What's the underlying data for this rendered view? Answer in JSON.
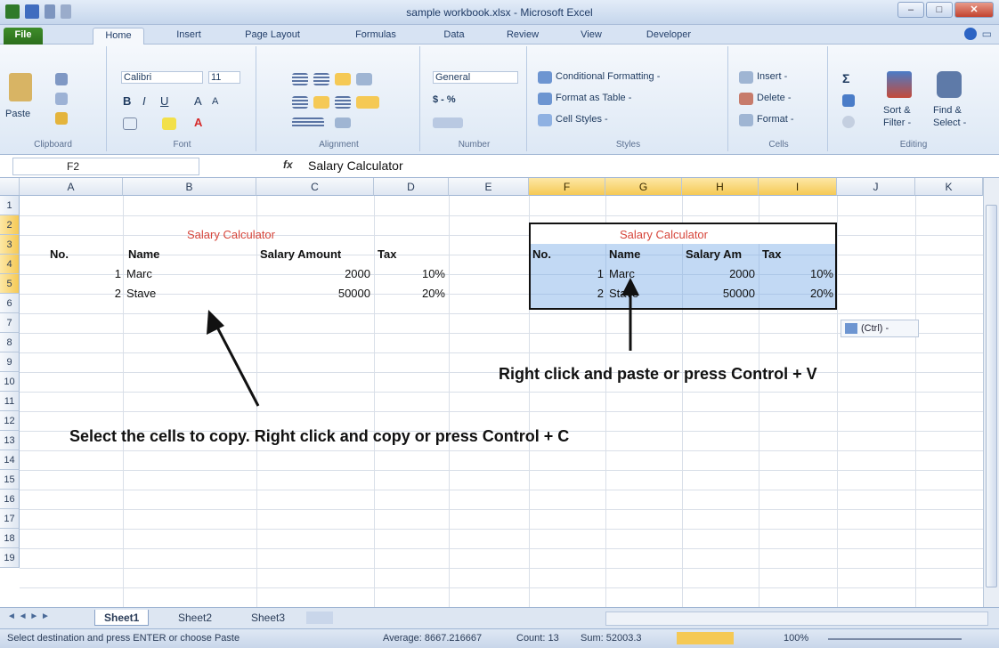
{
  "window": {
    "title": "sample workbook.xlsx - Microsoft Excel"
  },
  "tabs": [
    "File",
    "Home",
    "Insert",
    "Page Layout",
    "Formulas",
    "Data",
    "Review",
    "View",
    "Developer"
  ],
  "ribbon": {
    "clipboard": {
      "paste": "Paste",
      "label": "Clipboard"
    },
    "font": {
      "name": "Calibri",
      "size": "11",
      "label": "Font"
    },
    "alignment": {
      "label": "Alignment"
    },
    "number": {
      "format": "General",
      "currency": "$ - %",
      "label": "Number"
    },
    "styles": {
      "cond": "Conditional Formatting -",
      "table": "Format as Table -",
      "cell": "Cell Styles -",
      "label": "Styles"
    },
    "cells": {
      "insert": "Insert -",
      "delete": "Delete -",
      "format": "Format -",
      "label": "Cells"
    },
    "editing": {
      "sort": "Sort &",
      "filter": "Filter -",
      "find": "Find &",
      "select": "Select -",
      "label": "Editing"
    }
  },
  "formula_bar": {
    "name_box": "F2",
    "fx": "fx",
    "formula": "Salary Calculator"
  },
  "columns": [
    "A",
    "B",
    "C",
    "D",
    "E",
    "F",
    "G",
    "H",
    "I",
    "J",
    "K"
  ],
  "rows": [
    "1",
    "2",
    "3",
    "4",
    "5",
    "6",
    "7",
    "8",
    "9",
    "10",
    "11",
    "12",
    "13",
    "14",
    "15",
    "16",
    "17",
    "18",
    "19"
  ],
  "left_table": {
    "title": "Salary Calculator",
    "headers": [
      "No.",
      "Name",
      "Salary Amount",
      "Tax"
    ],
    "rows": [
      [
        "1",
        "Marc",
        "2000",
        "10%"
      ],
      [
        "2",
        "Stave",
        "50000",
        "20%"
      ]
    ]
  },
  "right_table": {
    "title": "Salary Calculator",
    "headers": [
      "No.",
      "Name",
      "Salary Am",
      "Tax"
    ],
    "rows": [
      [
        "1",
        "Marc",
        "2000",
        "10%"
      ],
      [
        "2",
        "Stave",
        "50000",
        "20%"
      ]
    ]
  },
  "annotations": {
    "paste_note": "Right click and paste or press Control + V",
    "copy_note": "Select the cells to copy. Right click and copy or press Control + C"
  },
  "paste_options": "(Ctrl) -",
  "sheet_tabs": [
    "Sheet1",
    "Sheet2",
    "Sheet3"
  ],
  "status": {
    "message": "Select destination and press ENTER or choose Paste",
    "average": "Average: 8667.216667",
    "count": "Count: 13",
    "sum": "Sum: 52003.3",
    "zoom": "100%"
  },
  "colors": {
    "accent_red": "#d6453a",
    "selection": "#78aae6",
    "file_tab": "#3f8d2a"
  }
}
